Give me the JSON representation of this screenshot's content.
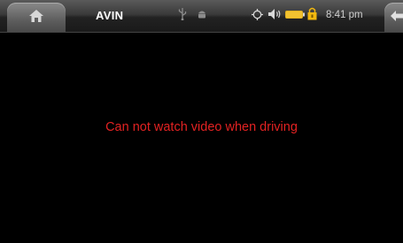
{
  "status_bar": {
    "title": "AVIN",
    "time": "8:41 pm",
    "icons": {
      "home": "home-icon",
      "usb": "usb-icon",
      "android": "android-debug-icon",
      "gps": "gps-icon",
      "volume": "volume-icon",
      "battery": "battery-icon",
      "lock": "lock-icon",
      "back": "back-arrow-icon"
    },
    "colors": {
      "battery_fill": "#f2c230",
      "lock": "#f2b80f"
    }
  },
  "main": {
    "warning_text": "Can not watch video when driving",
    "warning_color": "#e32222"
  }
}
